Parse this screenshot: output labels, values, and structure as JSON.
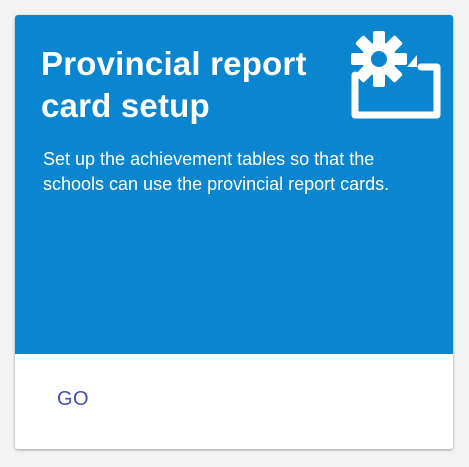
{
  "card": {
    "title": "Provincial report card setup",
    "description": "Set up the achievement tables so that the schools can use the provincial report cards.",
    "icon": "settings-gear-window-icon",
    "go_label": "GO"
  },
  "colors": {
    "header_background": "#0a85cf",
    "header_text": "#ffffff",
    "button_text": "#3f51b5",
    "card_background": "#ffffff",
    "page_background": "#f3f3f3"
  }
}
